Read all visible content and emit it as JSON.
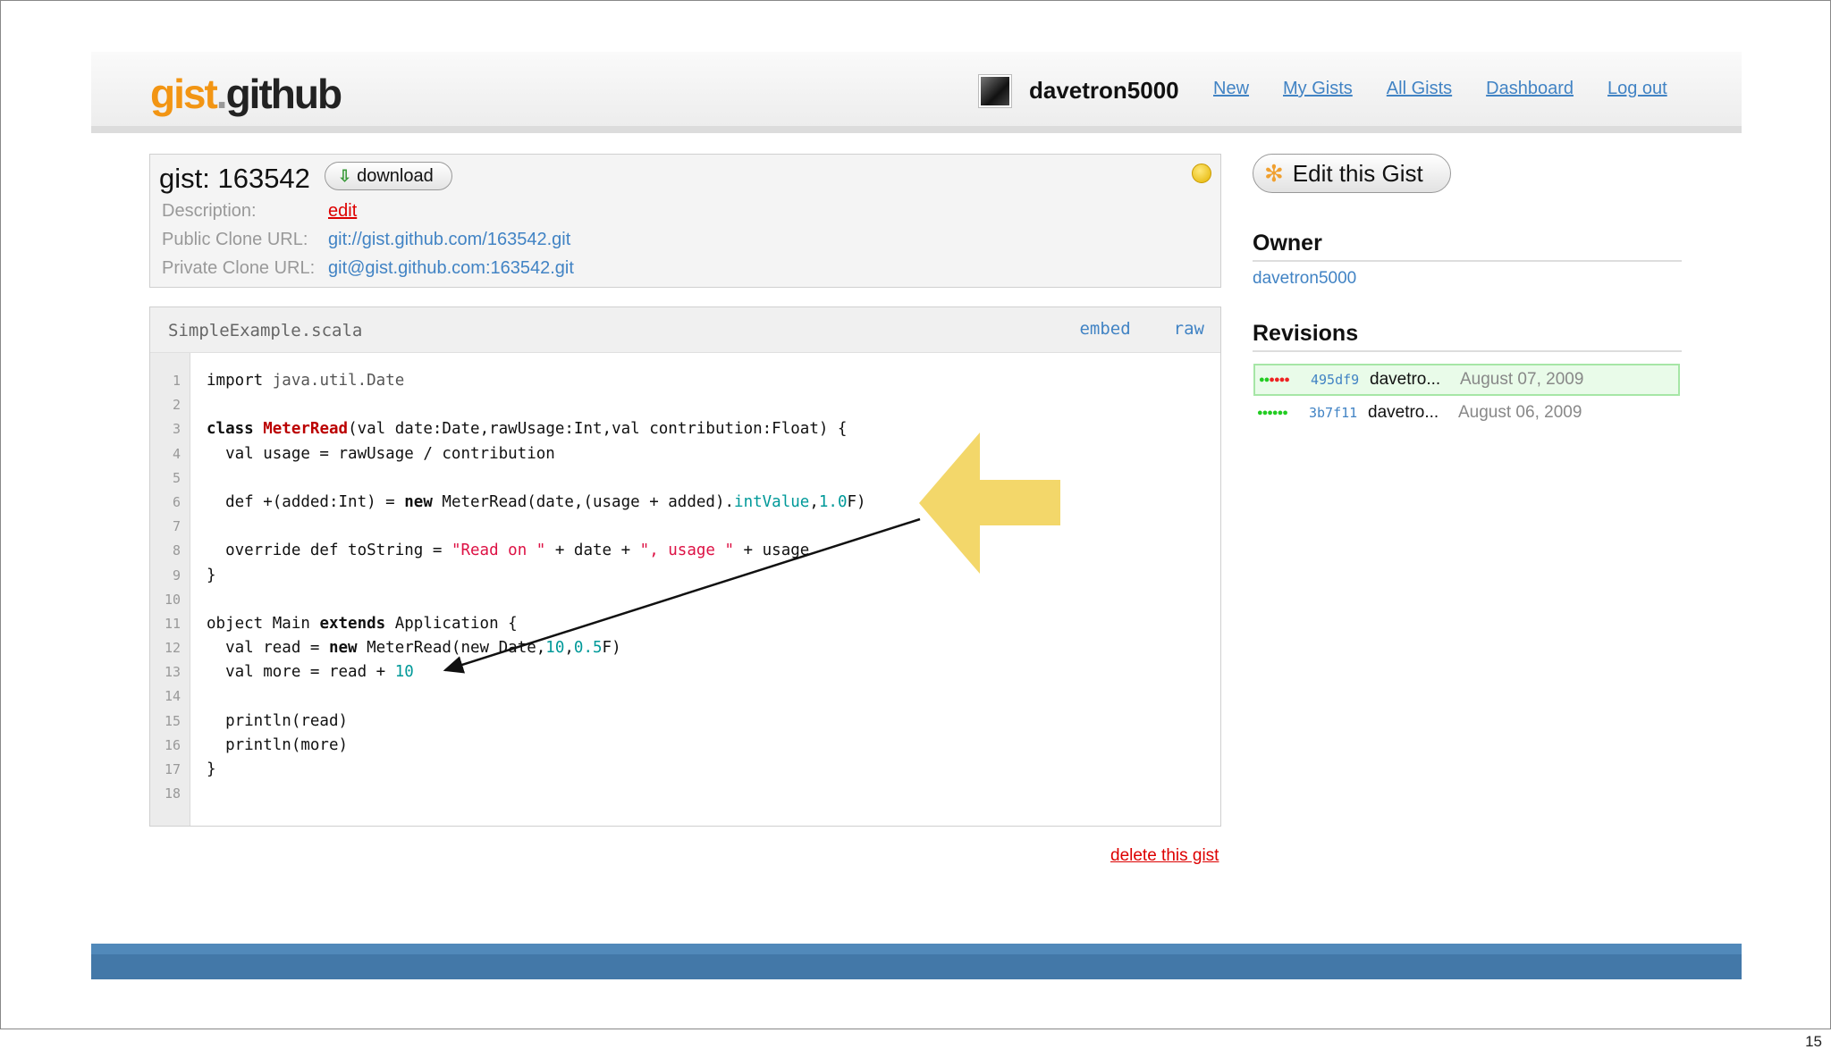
{
  "slide": {
    "page_number": "15"
  },
  "header": {
    "logo_part1": "gist",
    "logo_dot": ".",
    "logo_part2": "github",
    "username": "davetron5000",
    "nav": [
      "New",
      "My Gists",
      "All Gists",
      "Dashboard",
      "Log out"
    ]
  },
  "meta": {
    "title": "gist: 163542",
    "download_label": "download",
    "description_key": "Description:",
    "description_value": "edit",
    "public_key": "Public Clone URL:",
    "public_value": "git://gist.github.com/163542.git",
    "private_key": "Private Clone URL:",
    "private_value": "git@gist.github.com:163542.git"
  },
  "code": {
    "filename": "SimpleExample.scala",
    "embed_label": "embed",
    "raw_label": "raw",
    "line_numbers": [
      "1",
      "2",
      "3",
      "4",
      "5",
      "6",
      "7",
      "8",
      "9",
      "10",
      "11",
      "12",
      "13",
      "14",
      "15",
      "16",
      "17",
      "18"
    ]
  },
  "delete_label": "delete this gist",
  "sidebar": {
    "edit_label": "Edit this Gist",
    "owner_heading": "Owner",
    "owner_name": "davetron5000",
    "revisions_heading": "Revisions",
    "revisions": [
      {
        "sha": "495df9",
        "author": "davetro...",
        "date": "August 07, 2009"
      },
      {
        "sha": "3b7f11",
        "author": "davetro...",
        "date": "August 06, 2009"
      }
    ]
  },
  "colors": {
    "link": "#4183c4",
    "logo_orange": "#f29513",
    "footer": "#4378a8",
    "annotation_arrow": "#f2d35a"
  }
}
